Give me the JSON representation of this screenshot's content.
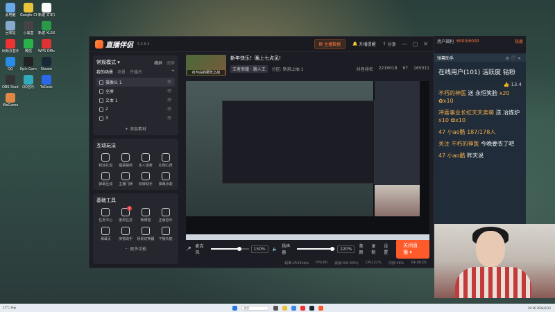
{
  "desktop_icons": [
    {
      "label": "此电脑",
      "color": "#6aa9e8"
    },
    {
      "label": "Google Chrome",
      "color": "#e9c43a"
    },
    {
      "label": "新建 文本文档",
      "color": "#fafafa"
    },
    {
      "label": "回收站",
      "color": "#88aacc"
    },
    {
      "label": "小黑盒",
      "color": "#444"
    },
    {
      "label": "新建 XLSX 工作表",
      "color": "#2a9a4a"
    },
    {
      "label": "网易云音乐",
      "color": "#e33"
    },
    {
      "label": "微信",
      "color": "#2ab24a"
    },
    {
      "label": "WPS Office",
      "color": "#d33"
    },
    {
      "label": "QQ",
      "color": "#2a8ae8"
    },
    {
      "label": "Epic Games Launcher",
      "color": "#222"
    },
    {
      "label": "Steam",
      "color": "#1b2838"
    },
    {
      "label": "OBS Studio",
      "color": "#333"
    },
    {
      "label": "QQ音乐",
      "color": "#3ab"
    },
    {
      "label": "ToDesk",
      "color": "#2a6ae8"
    },
    {
      "label": "WeGame",
      "color": "#d84"
    }
  ],
  "window": {
    "app_name": "直播伴侣",
    "version": "5.5.6.4",
    "main_data_btn": "主播数据",
    "help_btn": "升播提醒",
    "share_btn": "分享"
  },
  "scene": {
    "mode": "常规模式 ▾",
    "toggle_h": "横屏",
    "toggle_v": "竖屏",
    "title": "我的场景",
    "tab1": "我的",
    "tab2": "场景",
    "tab3": "传播名",
    "items": [
      {
        "label": "摄像头 1",
        "r": ""
      },
      {
        "label": "全屏",
        "r": ""
      },
      {
        "label": "文本 1",
        "r": ""
      },
      {
        "label": "2",
        "r": ""
      },
      {
        "label": "3",
        "r": ""
      }
    ],
    "add_source": "+ 添加素材"
  },
  "interact": {
    "title": "互动玩法",
    "tools": [
      {
        "label": "粉丝礼包"
      },
      {
        "label": "福袋抽奖"
      },
      {
        "label": "多人连麦"
      },
      {
        "label": "礼物心愿"
      },
      {
        "label": "弹幕互动"
      },
      {
        "label": "主播门牌"
      },
      {
        "label": "玩转助手"
      },
      {
        "label": "弹幕点歌"
      }
    ]
  },
  "basic": {
    "title": "基础工具",
    "tools": [
      {
        "label": "任务中心",
        "badge": ""
      },
      {
        "label": "度周任务",
        "badge": "1"
      },
      {
        "label": "赛博馆",
        "badge": ""
      },
      {
        "label": "正版音乐",
        "badge": ""
      },
      {
        "label": "弹幕页",
        "badge": ""
      },
      {
        "label": "房管助手",
        "badge": ""
      },
      {
        "label": "场景切换器",
        "badge": ""
      },
      {
        "label": "下播功能",
        "badge": ""
      }
    ],
    "more": "··· 更多功能"
  },
  "stream": {
    "cover_caption": "红与白的那年之战",
    "title": "新年快乐！晚上七点见!",
    "category": "王者荣耀 · 路人王",
    "partition": "分区: 新洞上抽 1",
    "stats": [
      "抖音排名",
      "2216018",
      "67",
      "165011"
    ]
  },
  "audio": {
    "mic_label": "麦克风",
    "mic_pct": "150%",
    "mic_level": 0.75,
    "speaker_label": "扬声器",
    "speaker_pct": "220%",
    "speaker_level": 0.92,
    "effects": "美颜",
    "record": "录制",
    "settings": "设置",
    "go_live": "关闭直播 ▾"
  },
  "status": [
    "码率:2533kb/s",
    "FPS:60",
    "丢帧:0(0.00%)",
    "CPU:21%",
    "内存:56%",
    "04:00:05"
  ],
  "top_right": {
    "label": "用户福利",
    "count": "6000/6000",
    "hot": "热度"
  },
  "danmaku": {
    "head": "弹幕助手",
    "online": "在线用户(101) 活跃度 钻粉",
    "likes": "13.4",
    "messages": [
      {
        "user": "不朽的神医",
        "text": "送 永恒笑脸",
        "extra": "x20 ✿x10"
      },
      {
        "user": "冲喜事业长虹天天卖萌",
        "text": "送 冶炼炉",
        "extra": "x10 ✿x10"
      },
      {
        "user": "47 小ao酷",
        "text": "",
        "extra": "187/178人"
      },
      {
        "user": "关注 不朽的神医",
        "text": "今晚要衣了吧",
        "extra": ""
      },
      {
        "user": "47 小ao酷",
        "text": "昨天说",
        "extra": ""
      }
    ]
  },
  "taskbar": {
    "weather": "15°C 多云",
    "search": "搜索",
    "time": "19:16 2024/2/12"
  }
}
